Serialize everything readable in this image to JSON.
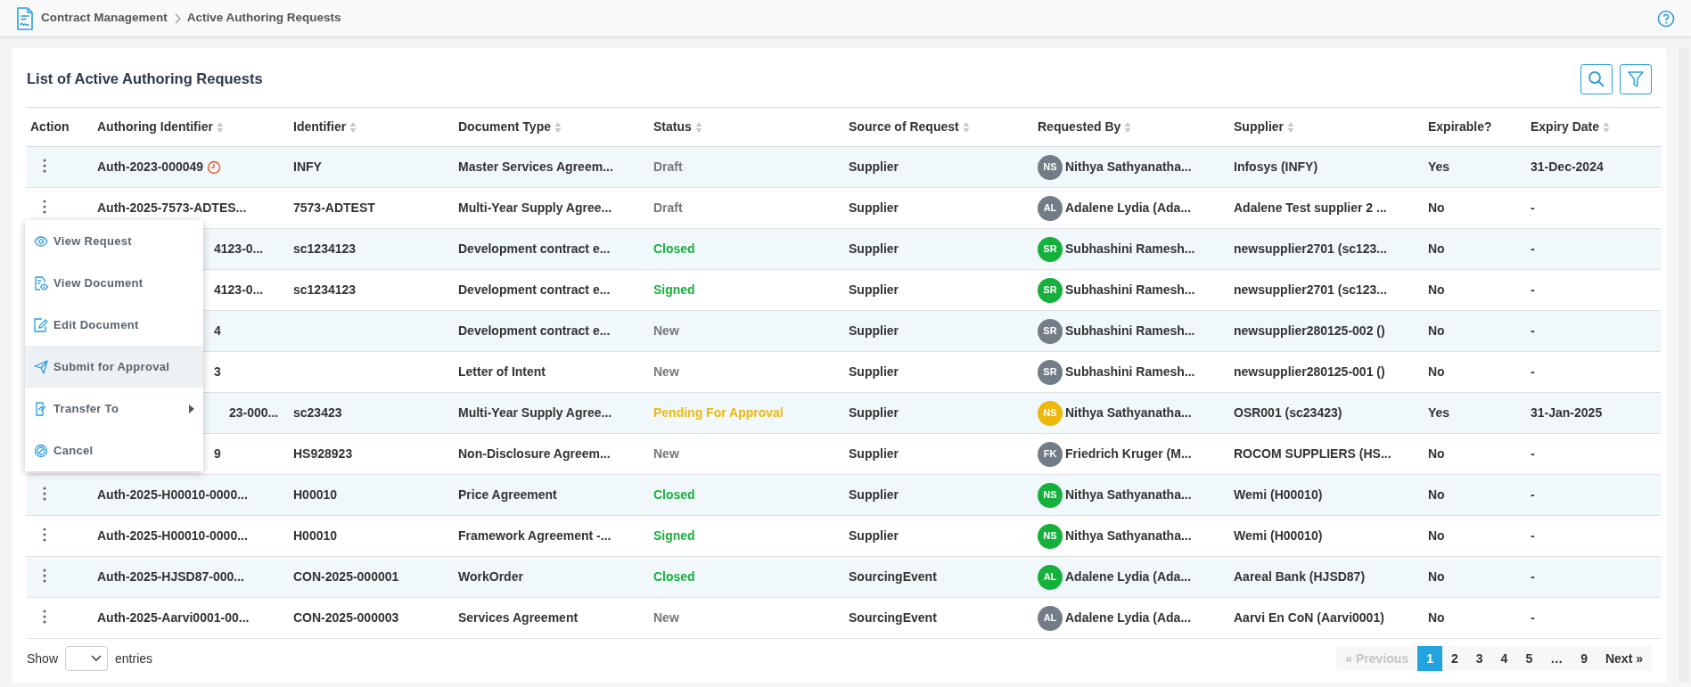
{
  "breadcrumb": [
    "Contract Management",
    "Active Authoring Requests"
  ],
  "card": {
    "title": "List of Active Authoring Requests"
  },
  "table": {
    "columns": [
      {
        "label": "Action",
        "sortable": false
      },
      {
        "label": "Authoring Identifier",
        "sortable": true
      },
      {
        "label": "Identifier",
        "sortable": true
      },
      {
        "label": "Document Type",
        "sortable": true
      },
      {
        "label": "Status",
        "sortable": true
      },
      {
        "label": "Source of Request",
        "sortable": true
      },
      {
        "label": "Requested By",
        "sortable": true
      },
      {
        "label": "Supplier",
        "sortable": true
      },
      {
        "label": "Expirable?",
        "sortable": false
      },
      {
        "label": "Expiry Date",
        "sortable": true
      }
    ],
    "rows": [
      {
        "menu_open": false,
        "authoring_id": "Auth-2023-000049",
        "timer": true,
        "identifier": "INFY",
        "document_type": "Master Services Agreem...",
        "status": {
          "text": "Draft",
          "color": "#777777"
        },
        "source": "Supplier",
        "requested_by": {
          "initials": "NS",
          "name": "Nithya Sathyanatha...",
          "color": "#737d87"
        },
        "supplier": "Infosys (INFY)",
        "expirable": "Yes",
        "expiry_date": "31-Dec-2024"
      },
      {
        "menu_open": true,
        "authoring_id": "Auth-2025-7573-ADTES...",
        "timer": false,
        "identifier": "7573-ADTEST",
        "document_type": "Multi-Year Supply Agree...",
        "status": {
          "text": "Draft",
          "color": "#777777"
        },
        "source": "Supplier",
        "requested_by": {
          "initials": "AL",
          "name": "Adalene Lydia (Ada...",
          "color": "#737d87"
        },
        "supplier": "Adalene Test supplier 2 ...",
        "expirable": "No",
        "expiry_date": "-"
      },
      {
        "menu_open": false,
        "authoring_id": "4123-0...",
        "timer": false,
        "identifier": "sc1234123",
        "document_type": "Development contract e...",
        "status": {
          "text": "Closed",
          "color": "#16b13c"
        },
        "source": "Supplier",
        "requested_by": {
          "initials": "SR",
          "name": "Subhashini Ramesh...",
          "color": "#16b13c"
        },
        "supplier": "newsupplier2701 (sc123...",
        "expirable": "No",
        "expiry_date": "-"
      },
      {
        "menu_open": false,
        "authoring_id": "4123-0...",
        "timer": false,
        "identifier": "sc1234123",
        "document_type": "Development contract e...",
        "status": {
          "text": "Signed",
          "color": "#16b13c"
        },
        "source": "Supplier",
        "requested_by": {
          "initials": "SR",
          "name": "Subhashini Ramesh...",
          "color": "#16b13c"
        },
        "supplier": "newsupplier2701 (sc123...",
        "expirable": "No",
        "expiry_date": "-"
      },
      {
        "menu_open": false,
        "authoring_id": "4",
        "timer": false,
        "identifier": "",
        "document_type": "Development contract e...",
        "status": {
          "text": "New",
          "color": "#777777"
        },
        "source": "Supplier",
        "requested_by": {
          "initials": "SR",
          "name": "Subhashini Ramesh...",
          "color": "#737d87"
        },
        "supplier": "newsupplier280125-002 ()",
        "expirable": "No",
        "expiry_date": "-"
      },
      {
        "menu_open": false,
        "authoring_id": "3",
        "timer": false,
        "identifier": "",
        "document_type": "Letter of Intent",
        "status": {
          "text": "New",
          "color": "#777777"
        },
        "source": "Supplier",
        "requested_by": {
          "initials": "SR",
          "name": "Subhashini Ramesh...",
          "color": "#737d87"
        },
        "supplier": "newsupplier280125-001 ()",
        "expirable": "No",
        "expiry_date": "-"
      },
      {
        "menu_open": false,
        "authoring_id": "23-000...",
        "timer": false,
        "identifier": "sc23423",
        "document_type": "Multi-Year Supply Agree...",
        "status": {
          "text": "Pending For Approval",
          "color": "#ecb90c"
        },
        "source": "Supplier",
        "requested_by": {
          "initials": "NS",
          "name": "Nithya Sathyanatha...",
          "color": "#ecb90c"
        },
        "supplier": "OSR001 (sc23423)",
        "expirable": "Yes",
        "expiry_date": "31-Jan-2025"
      },
      {
        "menu_open": false,
        "authoring_id": "9",
        "timer": false,
        "identifier": "HS928923",
        "document_type": "Non-Disclosure Agreem...",
        "status": {
          "text": "New",
          "color": "#777777"
        },
        "source": "Supplier",
        "requested_by": {
          "initials": "FK",
          "name": "Friedrich Kruger (M...",
          "color": "#737d87"
        },
        "supplier": "ROCOM SUPPLIERS (HS...",
        "expirable": "No",
        "expiry_date": "-"
      },
      {
        "menu_open": false,
        "authoring_id": "Auth-2025-H00010-0000...",
        "timer": false,
        "identifier": "H00010",
        "document_type": "Price Agreement",
        "status": {
          "text": "Closed",
          "color": "#16b13c"
        },
        "source": "Supplier",
        "requested_by": {
          "initials": "NS",
          "name": "Nithya Sathyanatha...",
          "color": "#16b13c"
        },
        "supplier": "Wemi (H00010)",
        "expirable": "No",
        "expiry_date": "-"
      },
      {
        "menu_open": false,
        "authoring_id": "Auth-2025-H00010-0000...",
        "timer": false,
        "identifier": "H00010",
        "document_type": "Framework Agreement -...",
        "status": {
          "text": "Signed",
          "color": "#16b13c"
        },
        "source": "Supplier",
        "requested_by": {
          "initials": "NS",
          "name": "Nithya Sathyanatha...",
          "color": "#16b13c"
        },
        "supplier": "Wemi (H00010)",
        "expirable": "No",
        "expiry_date": "-"
      },
      {
        "menu_open": false,
        "authoring_id": "Auth-2025-HJSD87-000...",
        "timer": false,
        "identifier": "CON-2025-000001",
        "document_type": "WorkOrder",
        "status": {
          "text": "Closed",
          "color": "#16b13c"
        },
        "source": "SourcingEvent",
        "requested_by": {
          "initials": "AL",
          "name": "Adalene Lydia (Ada...",
          "color": "#16b13c"
        },
        "supplier": "Aareal Bank (HJSD87)",
        "expirable": "No",
        "expiry_date": "-"
      },
      {
        "menu_open": false,
        "authoring_id": "Auth-2025-Aarvi0001-00...",
        "timer": false,
        "identifier": "CON-2025-000003",
        "document_type": "Services Agreement",
        "status": {
          "text": "New",
          "color": "#777777"
        },
        "source": "SourcingEvent",
        "requested_by": {
          "initials": "AL",
          "name": "Adalene Lydia (Ada...",
          "color": "#737d87"
        },
        "supplier": "Aarvi En CoN (Aarvi0001)",
        "expirable": "No",
        "expiry_date": "-"
      }
    ]
  },
  "action_menu": [
    {
      "kind": "view",
      "label": "View Request",
      "selected": false,
      "submenu": false
    },
    {
      "kind": "document",
      "label": "View Document",
      "selected": false,
      "submenu": false
    },
    {
      "kind": "edit",
      "label": "Edit Document",
      "selected": false,
      "submenu": false
    },
    {
      "kind": "send",
      "label": "Submit for Approval",
      "selected": true,
      "submenu": false
    },
    {
      "kind": "transfer",
      "label": "Transfer To",
      "selected": false,
      "submenu": true
    },
    {
      "kind": "cancel",
      "label": "Cancel",
      "selected": false,
      "submenu": false
    }
  ],
  "footer": {
    "show_label": "Show",
    "entries_label": "entries"
  },
  "pagination": [
    {
      "label": "« Previous",
      "selected": false,
      "disabled": true
    },
    {
      "label": "1",
      "selected": true,
      "disabled": false
    },
    {
      "label": "2",
      "selected": false,
      "disabled": false
    },
    {
      "label": "3",
      "selected": false,
      "disabled": false
    },
    {
      "label": "4",
      "selected": false,
      "disabled": false
    },
    {
      "label": "5",
      "selected": false,
      "disabled": false
    },
    {
      "label": "…",
      "selected": false,
      "disabled": false
    },
    {
      "label": "9",
      "selected": false,
      "disabled": false
    },
    {
      "label": "Next »",
      "selected": false,
      "disabled": false
    }
  ]
}
